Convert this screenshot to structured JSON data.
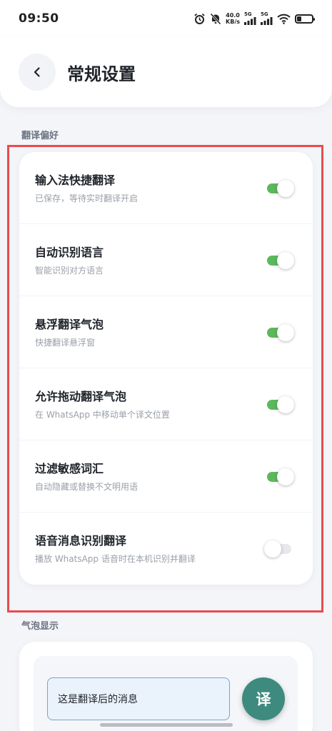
{
  "status_bar": {
    "time": "09:50",
    "net_speed_value": "40.0",
    "net_speed_unit": "KB/s",
    "signal_1_label": "5G",
    "signal_2_label": "5G",
    "icons": [
      "alarm-icon",
      "mute-bell-icon",
      "signal-icon",
      "signal-icon",
      "wifi-icon",
      "battery-icon"
    ]
  },
  "header": {
    "title": "常规设置",
    "back_icon": "chevron-left-icon"
  },
  "translation_prefs": {
    "section_label": "翻译偏好",
    "items": [
      {
        "title": "输入法快捷翻译",
        "subtitle": "已保存，等待实时翻译开启",
        "enabled": true
      },
      {
        "title": "自动识别语言",
        "subtitle": "智能识别对方语言",
        "enabled": true
      },
      {
        "title": "悬浮翻译气泡",
        "subtitle": "快捷翻译悬浮窗",
        "enabled": true
      },
      {
        "title": "允许拖动翻译气泡",
        "subtitle": "在 WhatsApp 中移动单个译文位置",
        "enabled": true
      },
      {
        "title": "过滤敏感词汇",
        "subtitle": "自动隐藏或替换不文明用语",
        "enabled": true
      },
      {
        "title": "语音消息识别翻译",
        "subtitle": "播放 WhatsApp 语音时在本机识别并翻译",
        "enabled": false
      }
    ]
  },
  "bubble_display": {
    "section_label": "气泡显示",
    "preview_message": "这是翻译后的消息",
    "fab_label": "译"
  },
  "colors": {
    "toggle_on": "#5cb85c",
    "toggle_off": "#e6e8eb",
    "fab": "#3f8a7e",
    "highlight": "#ea4b4f"
  }
}
